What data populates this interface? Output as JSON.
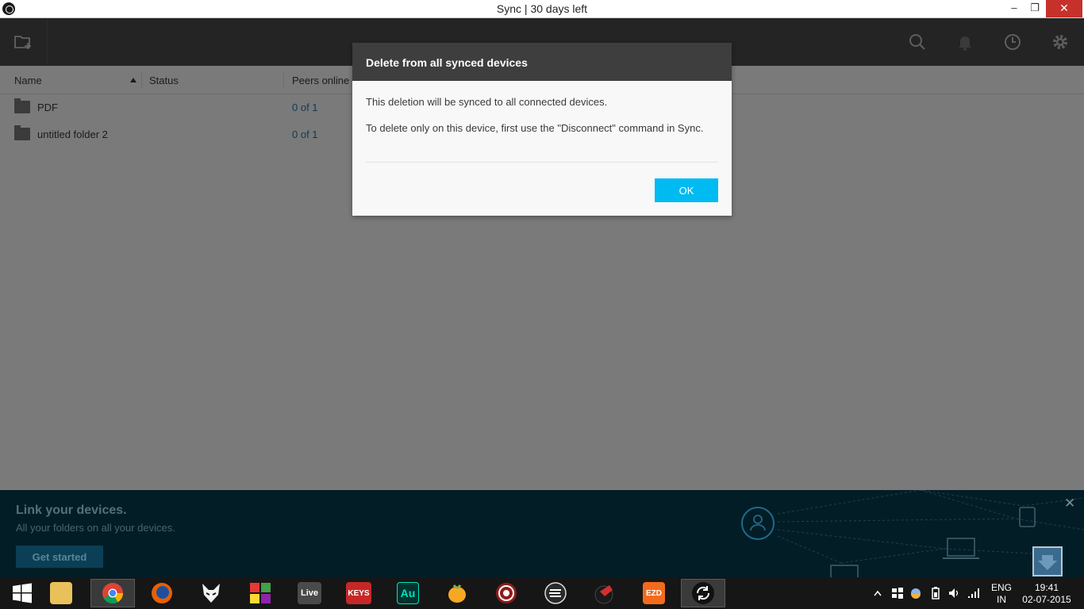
{
  "window": {
    "title": "Sync | 30 days left",
    "minimize": "–",
    "maximize": "❐",
    "close": "✕"
  },
  "header": {
    "icons": [
      "add-folder-icon",
      "search-icon",
      "bell-icon",
      "history-icon",
      "gear-icon"
    ]
  },
  "columns": {
    "name": "Name",
    "status": "Status",
    "peers": "Peers online"
  },
  "folders": [
    {
      "name": "PDF",
      "status": "",
      "peers": "0 of 1"
    },
    {
      "name": "untitled folder 2",
      "status": "",
      "peers": "0 of 1"
    }
  ],
  "dialog": {
    "title": "Delete from all synced devices",
    "line1": "This deletion will be synced to all connected devices.",
    "line2": "To delete only on this device, first use the \"Disconnect\" command in Sync.",
    "ok_label": "OK"
  },
  "banner": {
    "title": "Link your devices.",
    "subtitle": "All your folders on all your devices.",
    "button_label": "Get started",
    "close": "✕"
  },
  "taskbar": {
    "apps": [
      {
        "name": "file-explorer",
        "label": ""
      },
      {
        "name": "chrome",
        "label": ""
      },
      {
        "name": "firefox",
        "label": ""
      },
      {
        "name": "foobar",
        "label": ""
      },
      {
        "name": "windows-flag",
        "label": ""
      },
      {
        "name": "ableton-live",
        "label": "Live"
      },
      {
        "name": "keys",
        "label": "KEYS"
      },
      {
        "name": "audition",
        "label": "Au"
      },
      {
        "name": "fl-studio",
        "label": ""
      },
      {
        "name": "app-target",
        "label": ""
      },
      {
        "name": "app-e",
        "label": ""
      },
      {
        "name": "app-red",
        "label": ""
      },
      {
        "name": "ezdrummer",
        "label": "EZD"
      },
      {
        "name": "sync",
        "label": ""
      }
    ],
    "language": "ENG",
    "region": "IN",
    "time": "19:41",
    "date": "02-07-2015"
  },
  "colors": {
    "accent": "#00baf2",
    "header_bg": "#242424",
    "dialog_header": "#3e3e3e",
    "banner_bg": "#031d27"
  }
}
